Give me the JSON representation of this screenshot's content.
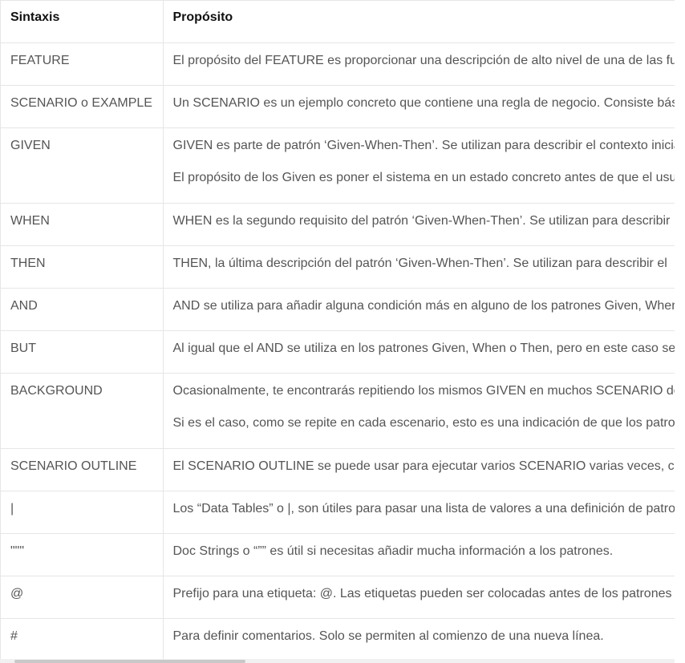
{
  "table": {
    "headers": [
      "Sintaxis",
      "Propósito"
    ],
    "rows": [
      {
        "syntax": "FEATURE",
        "purpose": [
          "El propósito del FEATURE es proporcionar una descripción de alto nivel de una de las fu"
        ]
      },
      {
        "syntax": "SCENARIO o EXAMPLE",
        "purpose": [
          "Un SCENARIO es un ejemplo concreto que contiene una regla de negocio. Consiste bás"
        ]
      },
      {
        "syntax": "GIVEN",
        "purpose": [
          "GIVEN es parte de patrón ‘Given-When-Then’. Se utilizan para describir el contexto inicia",
          "El propósito de los Given es poner el sistema en un estado concreto antes de que el usu"
        ]
      },
      {
        "syntax": "WHEN",
        "purpose": [
          "WHEN es la segundo requisito del patrón ‘Given-When-Then’. Se utilizan para describir"
        ]
      },
      {
        "syntax": "THEN",
        "purpose": [
          "THEN, la última descripción del patrón ‘Given-When-Then’.  Se utilizan para describir el"
        ]
      },
      {
        "syntax": "AND",
        "purpose": [
          "AND se utiliza para añadir alguna condición más en alguno de los patrones Given, Wher"
        ]
      },
      {
        "syntax": "BUT",
        "purpose": [
          "Al igual que el AND se utiliza en los patrones Given, When o Then, pero en este caso se"
        ]
      },
      {
        "syntax": "BACKGROUND",
        "purpose": [
          "Ocasionalmente, te encontrarás repitiendo los mismos GIVEN en muchos SCENARIO de",
          "Si es el caso, como se repite en cada escenario, esto es una indicación de que los patro"
        ]
      },
      {
        "syntax": "SCENARIO OUTLINE",
        "purpose": [
          "El SCENARIO OUTLINE se puede usar para ejecutar varios SCENARIO varias veces, c"
        ]
      },
      {
        "syntax": "|",
        "purpose": [
          "Los “Data Tables” o |, son útiles para pasar una lista de valores a una definición de patro"
        ]
      },
      {
        "syntax": "\"\"\"",
        "purpose": [
          "Doc Strings o “”” es útil si necesitas añadir mucha información a los patrones."
        ]
      },
      {
        "syntax": "@",
        "purpose": [
          "Prefijo para una etiqueta: @. Las etiquetas pueden ser colocadas antes de los patrones"
        ]
      },
      {
        "syntax": "#",
        "purpose": [
          "Para definir comentarios. Solo se permiten al comienzo de una nueva línea."
        ]
      }
    ]
  }
}
